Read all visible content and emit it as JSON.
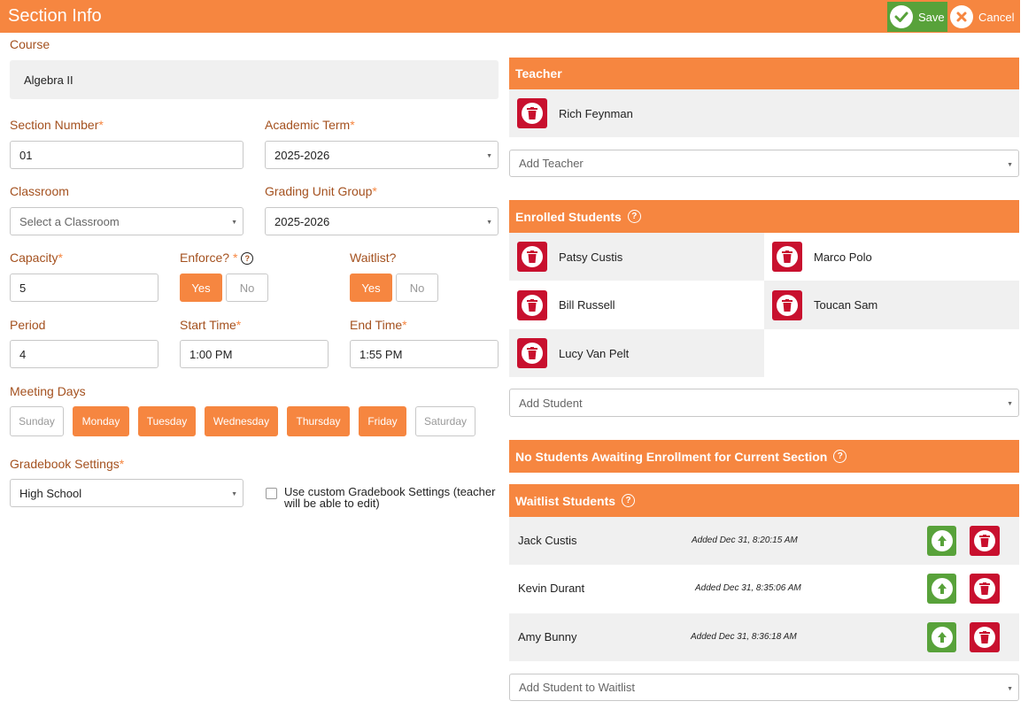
{
  "header": {
    "title": "Section Info",
    "save_label": "Save",
    "cancel_label": "Cancel"
  },
  "form": {
    "course_label": "Course",
    "course_value": "Algebra II",
    "section_number_label": "Section Number",
    "section_number_value": "01",
    "academic_term_label": "Academic Term",
    "academic_term_value": "2025-2026",
    "classroom_label": "Classroom",
    "classroom_placeholder": "Select a Classroom",
    "grading_unit_group_label": "Grading Unit Group",
    "grading_unit_group_value": "2025-2026",
    "capacity_label": "Capacity",
    "capacity_value": "5",
    "enforce_label": "Enforce?",
    "enforce_yes": "Yes",
    "enforce_no": "No",
    "waitlist_label": "Waitlist?",
    "waitlist_yes": "Yes",
    "waitlist_no": "No",
    "period_label": "Period",
    "period_value": "4",
    "start_time_label": "Start Time",
    "start_time_value": "1:00 PM",
    "end_time_label": "End Time",
    "end_time_value": "1:55 PM",
    "meeting_days_label": "Meeting Days",
    "days": [
      {
        "label": "Sunday",
        "selected": false
      },
      {
        "label": "Monday",
        "selected": true
      },
      {
        "label": "Tuesday",
        "selected": true
      },
      {
        "label": "Wednesday",
        "selected": true
      },
      {
        "label": "Thursday",
        "selected": true
      },
      {
        "label": "Friday",
        "selected": true
      },
      {
        "label": "Saturday",
        "selected": false
      }
    ],
    "gradebook_settings_label": "Gradebook Settings",
    "gradebook_settings_value": "High School",
    "custom_gradebook_label": "Use custom Gradebook Settings (teacher will be able to edit)",
    "required_mark": "*"
  },
  "teacher": {
    "title": "Teacher",
    "name": "Rich Feynman",
    "add_placeholder": "Add Teacher"
  },
  "enrolled": {
    "title": "Enrolled Students",
    "students": [
      "Patsy Custis",
      "Marco Polo",
      "Bill Russell",
      "Toucan Sam",
      "Lucy Van Pelt"
    ],
    "add_placeholder": "Add Student"
  },
  "awaiting": {
    "title": "No Students Awaiting Enrollment for Current Section"
  },
  "waitlist": {
    "title": "Waitlist Students",
    "students": [
      {
        "name": "Jack Custis",
        "added": "Added Dec 31, 8:20:15 AM"
      },
      {
        "name": "Kevin Durant",
        "added": "Added Dec 31, 8:35:06 AM"
      },
      {
        "name": "Amy Bunny",
        "added": "Added Dec 31, 8:36:18 AM"
      }
    ],
    "add_placeholder": "Add Student to Waitlist"
  },
  "colors": {
    "accent": "#f68640",
    "label": "#a4511f",
    "success": "#58a23a",
    "danger": "#c8102e",
    "panel": "#f0f0f0"
  }
}
